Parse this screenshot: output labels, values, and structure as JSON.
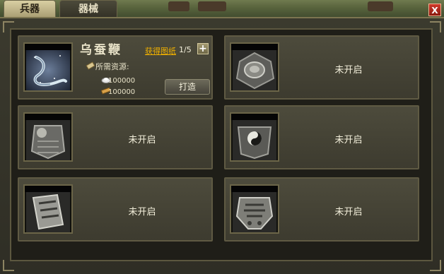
{
  "tabs": [
    {
      "label": "兵器",
      "active": true
    },
    {
      "label": "器械",
      "active": false
    }
  ],
  "close_label": "X",
  "weapon": {
    "name": "乌蚕鞭",
    "blueprint_link": "获得图纸",
    "blueprint_count": "1/5",
    "plus_label": "+",
    "resources_label": "所需资源:",
    "resources": [
      {
        "icon": "silver-ingot-icon",
        "value": "100000"
      },
      {
        "icon": "material-bundle-icon",
        "value": "100000"
      }
    ],
    "forge_button": "打造"
  },
  "locked_slots": [
    {
      "text": "未开启",
      "icon": "bagua-shield-icon"
    },
    {
      "text": "未开启",
      "icon": "beast-head-armor-icon"
    },
    {
      "text": "未开启",
      "icon": "taiji-armor-icon"
    },
    {
      "text": "未开启",
      "icon": "talisman-scroll-icon"
    },
    {
      "text": "未开启",
      "icon": "engraved-plaque-icon"
    }
  ]
}
